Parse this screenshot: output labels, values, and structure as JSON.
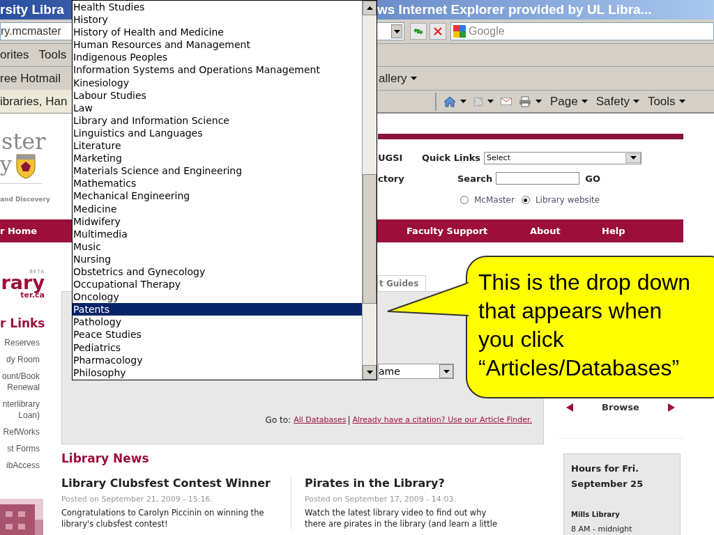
{
  "window": {
    "title_start": "rsity Libra",
    "title_end": "ws Internet Explorer provided by UL Libra..."
  },
  "address_bar": {
    "url": "ry.mcmaster",
    "search_placeholder": "Google"
  },
  "menu_bar": [
    "orites",
    "Tools"
  ],
  "favorites_bar": [
    "ree Hotmail",
    "allery"
  ],
  "tab": {
    "title": "ibraries, Han"
  },
  "command_bar": [
    "Page",
    "Safety",
    "Tools"
  ],
  "header": {
    "logo_text": "ster",
    "logo_text_2": "y",
    "tagline": "and Discovery",
    "links": [
      "UGSI",
      "ctory"
    ],
    "quick_links_label": "Quick Links",
    "quick_links_value": "Select",
    "search_label": "Search",
    "go": "GO",
    "scopes": [
      {
        "label": "McMaster",
        "selected": false
      },
      {
        "label": "Library website",
        "selected": true
      }
    ]
  },
  "nav": [
    "r Home",
    "Faculty Support",
    "About",
    "Help"
  ],
  "sidebar": {
    "logo": "rary",
    "logo_badge": "BETA",
    "logo_domain": "ter.ca",
    "heading": "r Links",
    "items": [
      "Reserves",
      "dy Room",
      "ount/Book Renewal",
      "nterlibrary Loan)",
      "RefWorks",
      "st Forms",
      "ibAccess"
    ]
  },
  "search_panel": {
    "tab": "t Guides",
    "select_value": "ame",
    "goto_label": "Go to:",
    "links": [
      "All Databases",
      "Already have a citation? Use our Article Finder."
    ]
  },
  "news": {
    "heading": "Library News",
    "posts": [
      {
        "title": "Library Clubsfest Contest Winner",
        "posted": "Posted on September 21, 2009 - 15:16.",
        "body": "Congratulations to Carolyn Piccinin on winning the library's clubsfest contest!"
      },
      {
        "title": "Pirates in the Library?",
        "posted": "Posted on September 17, 2009 - 14:03.",
        "body": "Watch the latest library video to find out why there are pirates in the library (and learn a little"
      }
    ]
  },
  "browse": {
    "label": "Browse"
  },
  "hours": {
    "title": "Hours for Fri. September 25",
    "library": "Mills Library",
    "time": "8 AM - midnight"
  },
  "dropdown": {
    "options": [
      {
        "label": "Health Studies",
        "selected": false
      },
      {
        "label": "History",
        "selected": false
      },
      {
        "label": "History of Health and Medicine",
        "selected": false
      },
      {
        "label": "Human Resources and Management",
        "selected": false
      },
      {
        "label": "Indigenous Peoples",
        "selected": false
      },
      {
        "label": "Information Systems and Operations Management",
        "selected": false
      },
      {
        "label": "Kinesiology",
        "selected": false
      },
      {
        "label": "Labour Studies",
        "selected": false
      },
      {
        "label": "Law",
        "selected": false
      },
      {
        "label": "Library and Information Science",
        "selected": false
      },
      {
        "label": "Linguistics and Languages",
        "selected": false
      },
      {
        "label": "Literature",
        "selected": false
      },
      {
        "label": "Marketing",
        "selected": false
      },
      {
        "label": "Materials Science and Engineering",
        "selected": false
      },
      {
        "label": "Mathematics",
        "selected": false
      },
      {
        "label": "Mechanical Engineering",
        "selected": false
      },
      {
        "label": "Medicine",
        "selected": false
      },
      {
        "label": "Midwifery",
        "selected": false
      },
      {
        "label": "Multimedia",
        "selected": false
      },
      {
        "label": "Music",
        "selected": false
      },
      {
        "label": "Nursing",
        "selected": false
      },
      {
        "label": "Obstetrics and Gynecology",
        "selected": false
      },
      {
        "label": "Occupational Therapy",
        "selected": false
      },
      {
        "label": "Oncology",
        "selected": false
      },
      {
        "label": "Patents",
        "selected": true
      },
      {
        "label": "Pathology",
        "selected": false
      },
      {
        "label": "Peace Studies",
        "selected": false
      },
      {
        "label": "Pediatrics",
        "selected": false
      },
      {
        "label": "Pharmacology",
        "selected": false
      },
      {
        "label": "Philosophy",
        "selected": false
      }
    ]
  },
  "callout": {
    "text": "This is the drop down that appears when you click “Articles/Databases”"
  }
}
